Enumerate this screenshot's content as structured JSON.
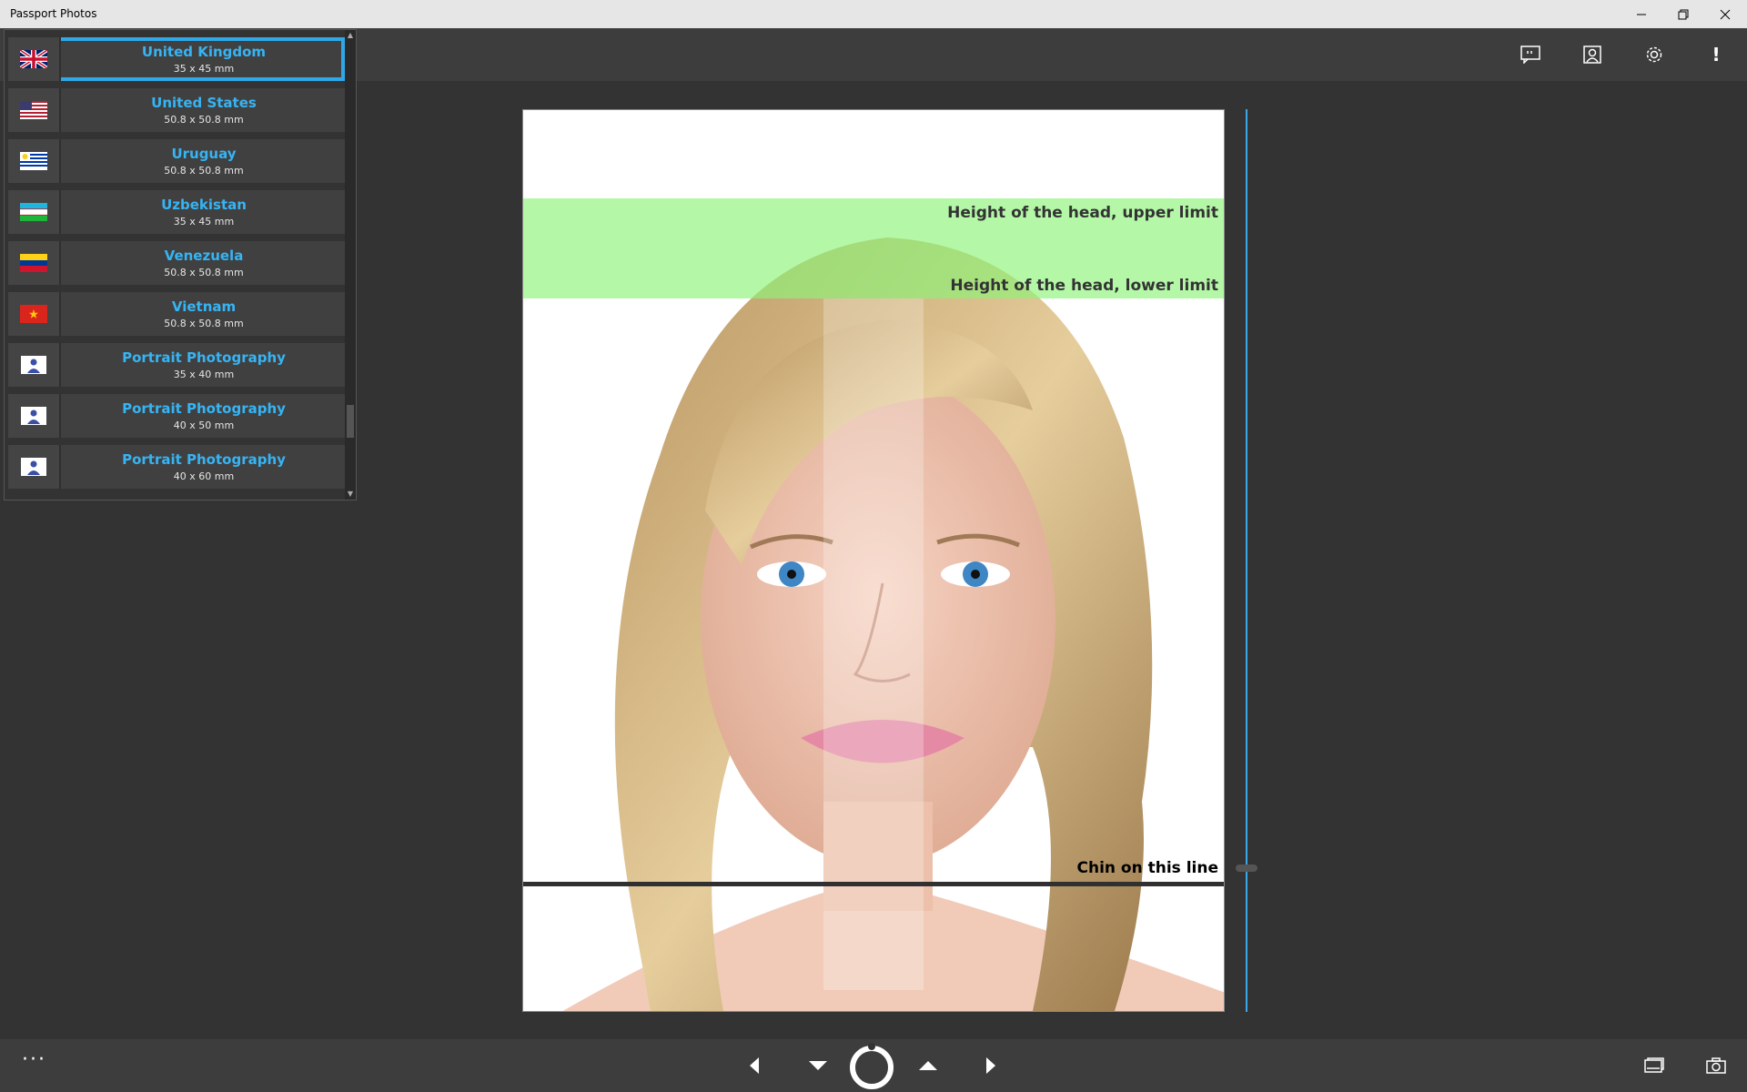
{
  "window": {
    "title": "Passport Photos",
    "controls": [
      "minimize-icon",
      "restore-icon",
      "close-icon"
    ]
  },
  "appbar": {
    "icons": [
      "feedback-icon",
      "portrait-icon",
      "settings-icon",
      "alert-icon"
    ],
    "alert_text": "!"
  },
  "countries": [
    {
      "name": "United Kingdom",
      "size": "35 x 45 mm",
      "flag": "uk-flag-icon",
      "selected": true
    },
    {
      "name": "United States",
      "size": "50.8 x 50.8 mm",
      "flag": "us-flag-icon"
    },
    {
      "name": "Uruguay",
      "size": "50.8 x 50.8 mm",
      "flag": "uruguay-flag-icon"
    },
    {
      "name": "Uzbekistan",
      "size": "35 x 45 mm",
      "flag": "uzbekistan-flag-icon"
    },
    {
      "name": "Venezuela",
      "size": "50.8 x 50.8 mm",
      "flag": "venezuela-flag-icon"
    },
    {
      "name": "Vietnam",
      "size": "50.8 x 50.8 mm",
      "flag": "vietnam-flag-icon"
    },
    {
      "name": "Portrait Photography",
      "size": "35 x 40 mm",
      "flag": "portrait-icon"
    },
    {
      "name": "Portrait Photography",
      "size": "40 x 50 mm",
      "flag": "portrait-icon"
    },
    {
      "name": "Portrait Photography",
      "size": "40 x 60 mm",
      "flag": "portrait-icon"
    }
  ],
  "photo": {
    "upper_limit_label": "Height of the head, upper limit",
    "lower_limit_label": "Height of the head, lower limit",
    "chin_label": "Chin on this line"
  },
  "bottombar": {
    "more_label": "···",
    "controls": [
      "left-arrow-icon",
      "down-arrow-icon",
      "rotate-ring-icon",
      "up-arrow-icon",
      "right-arrow-icon"
    ],
    "right_icons": [
      "gallery-icon",
      "camera-icon"
    ]
  },
  "colors": {
    "accent": "#36b4f4",
    "guide_green": "#8cf578",
    "background": "#333333"
  }
}
